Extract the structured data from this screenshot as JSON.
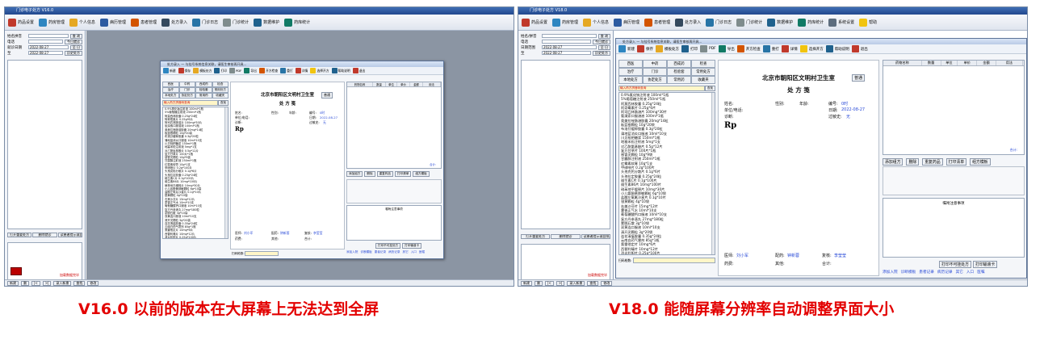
{
  "left_shot": {
    "window_title": "门诊电子处方 V16.0",
    "toolbar": [
      {
        "label": "药品设置",
        "icon": "pill-icon",
        "color": "#c0392b"
      },
      {
        "label": "药房管理",
        "icon": "cube-icon",
        "color": "#2e86c1"
      },
      {
        "label": "个人信息",
        "icon": "folder-icon",
        "color": "#e5a823"
      },
      {
        "label": "病历管理",
        "icon": "chart-icon",
        "color": "#2c5aa0"
      },
      {
        "label": "患者管理",
        "icon": "people-icon",
        "color": "#d35400"
      },
      {
        "label": "处方录入",
        "icon": "arrows-icon",
        "color": "#34495e"
      },
      {
        "label": "门诊日志",
        "icon": "calendar-icon",
        "color": "#2874a6"
      },
      {
        "label": "门诊统计",
        "icon": "document-icon",
        "color": "#7f8c8d"
      },
      {
        "label": "数据维护",
        "icon": "bar-icon",
        "color": "#1f618d"
      },
      {
        "label": "药库统计",
        "icon": "stats-icon",
        "color": "#117a65"
      }
    ],
    "sidebar": {
      "rows": [
        {
          "label": "姓名拼音",
          "value": "",
          "button": "查 询"
        },
        {
          "label": "电话",
          "value": "",
          "button": "今日就诊"
        },
        {
          "label": "就诊日期",
          "value": "2022-08-27",
          "button": "至 日"
        },
        {
          "label": "至",
          "value": "2022-08-27",
          "button": "历史处方"
        }
      ],
      "bottom_buttons": [
        "打开重要处方",
        "删除就诊",
        "读患者提示或自拟"
      ],
      "status_text": "加载数据完毕"
    },
    "statusbar": [
      "新建",
      "删",
      "|<",
      ">|",
      "录入新患",
      "查找",
      "修改"
    ],
    "dialog": {
      "title": "处方录入 — 与挂号系统信息关联，请医生审核再开具...",
      "tools": [
        "新建",
        "保存",
        "模板处方",
        "打印",
        "PDF",
        "导出",
        "开方检查",
        "重打",
        "详情",
        "选择开方",
        "帮助说明",
        "退出"
      ],
      "tabs": [
        "西医",
        "中药",
        "西成药",
        "检查",
        "治疗",
        "门诊",
        "检验套",
        "常用处方",
        "本地处方",
        "协定处方",
        "常用药",
        "收藏夹"
      ],
      "search_placeholder": "输入药方拼音码查询",
      "search_button": "查找",
      "drugs": [
        "0.9%氯化钠注射液 100ml*1瓶",
        "5%葡萄糖注射液 250ml*1瓶",
        "阿莫西林胶囊 0.25g*24粒",
        "阿奇霉素片 0.25g*6片",
        "阿司匹林肠溶片 100mg*30片",
        "氨溴索口服溶液 100ml*1瓶",
        "奥美拉唑肠溶胶囊 20mg*14粒",
        "板蓝根颗粒 10g*20袋",
        "布洛芬缓释胶囊 0.3g*20粒",
        "蒲地蓝消炎口服液 10ml*10支",
        "川贝枇杷糖浆 150ml*1瓶",
        "地塞米松注射液 5mg*1支",
        "对乙酰氨基酚片 0.5g*12片",
        "复方甘草片 100片*1瓶",
        "感冒灵颗粒 10g*9袋",
        "甘露醇注射液 250ml*1瓶",
        "红霉素软膏 10g*1支",
        "甲硝唑片 0.2g*100片",
        "头孢克肟分散片 0.1g*6片",
        "头孢拉定胶囊 0.25g*24粒",
        "维生素C片 0.1g*100片",
        "维生素B6片 10mg*100片",
        "硝苯地平缓释片 10mg*30片",
        "小儿氨酚黄那敏颗粒 6g*10袋",
        "盐酸左氧氟沙星片 0.1g*10片",
        "银黄颗粒 4g*10袋",
        "右美沙芬片 15mg*12片",
        "藿香正气水 10ml*10支",
        "葡萄糖酸钙口服液 10ml*10支",
        "复方丹参滴丸 27mg*180粒",
        "蒙脱石散 3g*10袋",
        "双黄连口服液 10ml*10支",
        "清开灵颗粒 3g*20袋",
        "连花清瘟胶囊 0.35g*24粒",
        "云南白药气雾剂 85g*1瓶",
        "氯雷他定片 10mg*6片",
        "西替利嗪片 10mg*12片",
        "消炎利胆片 0.25g*100片"
      ],
      "paper": {
        "clinic": "北京市朝阳区文明村卫生室",
        "doc_type": "处 方 笺",
        "print_button": "普通",
        "name_label": "姓名:",
        "gender_label": "性别:",
        "age_label": "年龄:",
        "id_label": "编号:",
        "id_value": "0时",
        "unit_label": "单位/电话:",
        "date_label": "日期:",
        "date_value": "2022-08-27",
        "diag_label": "诊断:",
        "allergy_label": "过敏史:",
        "allergy_value": "无",
        "rp": "Rp",
        "doctor_label": "医师:",
        "doctor_value": "刘小军",
        "dispense_label": "配药:",
        "dispense_value": "钟新蓉",
        "check_label": "复核:",
        "check_value": "李莹莹",
        "fee_label": "药费:",
        "other_label": "其他:",
        "total_label": "合计:"
      },
      "table_headers": [
        "药物名称",
        "数量",
        "单位",
        "单价",
        "金额",
        "用法"
      ],
      "total_text": "合计:",
      "right_buttons_1": [
        "添加组方",
        "删除",
        "重复药品",
        "打印清单",
        "组方模板"
      ],
      "right_buttons_2": [
        "打印不可挂处方",
        "打印输液卡"
      ],
      "notes_label": "嘱咐注意事项",
      "bottom_links": [
        "添加入院",
        "诊断模板",
        "患者记录",
        "病历记录",
        "其它",
        "入口",
        "医嘱"
      ],
      "tip_label": "扫码枪数:"
    }
  },
  "right_shot": {
    "window_title": "门诊电子处方 V18.0",
    "toolbar": [
      {
        "label": "药品设置",
        "icon": "pill-icon",
        "color": "#c0392b"
      },
      {
        "label": "药房管理",
        "icon": "cube-icon",
        "color": "#2e86c1"
      },
      {
        "label": "个人信息",
        "icon": "folder-icon",
        "color": "#e5a823"
      },
      {
        "label": "病历管理",
        "icon": "chart-icon",
        "color": "#2c5aa0"
      },
      {
        "label": "患者管理",
        "icon": "people-icon",
        "color": "#d35400"
      },
      {
        "label": "处方录入",
        "icon": "arrows-icon",
        "color": "#34495e"
      },
      {
        "label": "门诊日志",
        "icon": "calendar-icon",
        "color": "#2874a6"
      },
      {
        "label": "门诊统计",
        "icon": "document-icon",
        "color": "#7f8c8d"
      },
      {
        "label": "数据维护",
        "icon": "bar-icon",
        "color": "#1f618d"
      },
      {
        "label": "药库统计",
        "icon": "stats-icon",
        "color": "#117a65"
      },
      {
        "label": "系统设置",
        "icon": "gear-icon",
        "color": "#5d6d7e"
      },
      {
        "label": "帮助",
        "icon": "help-icon",
        "color": "#f1c40f"
      }
    ],
    "sidebar": {
      "rows": [
        {
          "label": "姓名/拼音",
          "value": "",
          "button": "查 询"
        },
        {
          "label": "电话",
          "value": "",
          "button": "今日就诊"
        },
        {
          "label": "日期范围",
          "value": "2022-08-27",
          "button": "至 日"
        },
        {
          "label": "至",
          "value": "2022-08-27",
          "button": "历史处方"
        }
      ],
      "bottom_buttons": [
        "打开重要处方",
        "删除就诊",
        "读患者提示或自拟"
      ],
      "status_text": "加载数据完毕"
    },
    "statusbar": [
      "新建",
      "删",
      "|<",
      ">|",
      "录入新患",
      "查找",
      "修改"
    ],
    "caption_left": "V16.0 以前的版本在大屏幕上无法达到全屏",
    "caption_right": "V18.0 能随屏幕分辨率自动调整界面大小"
  }
}
